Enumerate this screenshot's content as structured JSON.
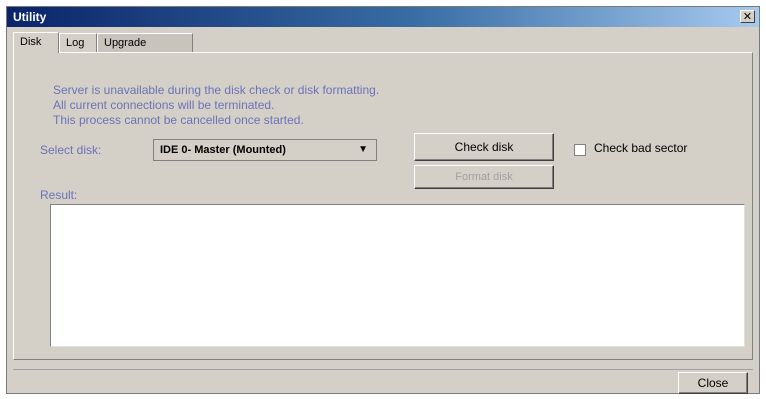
{
  "window": {
    "title": "Utility",
    "close_glyph": "✕"
  },
  "tabs": [
    {
      "label": "Disk",
      "active": true
    },
    {
      "label": "Log",
      "active": false
    },
    {
      "label": "Upgrade",
      "active": false
    }
  ],
  "notice": {
    "lines": [
      "Server is unavailable during the disk check or disk formatting.",
      "All current connections will be terminated.",
      "This process cannot be cancelled once started."
    ]
  },
  "disk": {
    "select_label": "Select disk:",
    "selected": "IDE 0- Master (Mounted)",
    "dropdown_arrow": "▼",
    "check_disk_label": "Check disk",
    "format_disk_label": "Format disk",
    "bad_sector_label": "Check bad sector",
    "bad_sector_checked": false
  },
  "result": {
    "label": "Result:",
    "content": ""
  },
  "footer": {
    "close_label": "Close"
  },
  "colors": {
    "accent_text": "#6a73b8",
    "title_bar": "#0a246a",
    "window_bg": "#d4d0c8"
  }
}
